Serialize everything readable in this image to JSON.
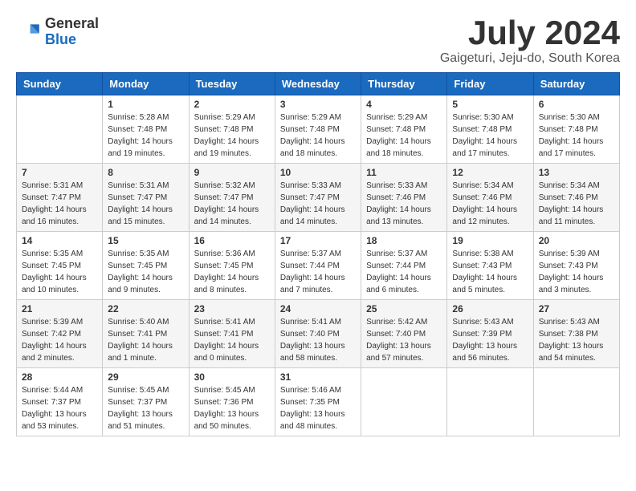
{
  "header": {
    "logo_general": "General",
    "logo_blue": "Blue",
    "month_title": "July 2024",
    "subtitle": "Gaigeturi, Jeju-do, South Korea"
  },
  "weekdays": [
    "Sunday",
    "Monday",
    "Tuesday",
    "Wednesday",
    "Thursday",
    "Friday",
    "Saturday"
  ],
  "weeks": [
    [
      {
        "day": "",
        "sunrise": "",
        "sunset": "",
        "daylight": ""
      },
      {
        "day": "1",
        "sunrise": "5:28 AM",
        "sunset": "7:48 PM",
        "daylight": "14 hours and 19 minutes."
      },
      {
        "day": "2",
        "sunrise": "5:29 AM",
        "sunset": "7:48 PM",
        "daylight": "14 hours and 19 minutes."
      },
      {
        "day": "3",
        "sunrise": "5:29 AM",
        "sunset": "7:48 PM",
        "daylight": "14 hours and 18 minutes."
      },
      {
        "day": "4",
        "sunrise": "5:29 AM",
        "sunset": "7:48 PM",
        "daylight": "14 hours and 18 minutes."
      },
      {
        "day": "5",
        "sunrise": "5:30 AM",
        "sunset": "7:48 PM",
        "daylight": "14 hours and 17 minutes."
      },
      {
        "day": "6",
        "sunrise": "5:30 AM",
        "sunset": "7:48 PM",
        "daylight": "14 hours and 17 minutes."
      }
    ],
    [
      {
        "day": "7",
        "sunrise": "5:31 AM",
        "sunset": "7:47 PM",
        "daylight": "14 hours and 16 minutes."
      },
      {
        "day": "8",
        "sunrise": "5:31 AM",
        "sunset": "7:47 PM",
        "daylight": "14 hours and 15 minutes."
      },
      {
        "day": "9",
        "sunrise": "5:32 AM",
        "sunset": "7:47 PM",
        "daylight": "14 hours and 14 minutes."
      },
      {
        "day": "10",
        "sunrise": "5:33 AM",
        "sunset": "7:47 PM",
        "daylight": "14 hours and 14 minutes."
      },
      {
        "day": "11",
        "sunrise": "5:33 AM",
        "sunset": "7:46 PM",
        "daylight": "14 hours and 13 minutes."
      },
      {
        "day": "12",
        "sunrise": "5:34 AM",
        "sunset": "7:46 PM",
        "daylight": "14 hours and 12 minutes."
      },
      {
        "day": "13",
        "sunrise": "5:34 AM",
        "sunset": "7:46 PM",
        "daylight": "14 hours and 11 minutes."
      }
    ],
    [
      {
        "day": "14",
        "sunrise": "5:35 AM",
        "sunset": "7:45 PM",
        "daylight": "14 hours and 10 minutes."
      },
      {
        "day": "15",
        "sunrise": "5:35 AM",
        "sunset": "7:45 PM",
        "daylight": "14 hours and 9 minutes."
      },
      {
        "day": "16",
        "sunrise": "5:36 AM",
        "sunset": "7:45 PM",
        "daylight": "14 hours and 8 minutes."
      },
      {
        "day": "17",
        "sunrise": "5:37 AM",
        "sunset": "7:44 PM",
        "daylight": "14 hours and 7 minutes."
      },
      {
        "day": "18",
        "sunrise": "5:37 AM",
        "sunset": "7:44 PM",
        "daylight": "14 hours and 6 minutes."
      },
      {
        "day": "19",
        "sunrise": "5:38 AM",
        "sunset": "7:43 PM",
        "daylight": "14 hours and 5 minutes."
      },
      {
        "day": "20",
        "sunrise": "5:39 AM",
        "sunset": "7:43 PM",
        "daylight": "14 hours and 3 minutes."
      }
    ],
    [
      {
        "day": "21",
        "sunrise": "5:39 AM",
        "sunset": "7:42 PM",
        "daylight": "14 hours and 2 minutes."
      },
      {
        "day": "22",
        "sunrise": "5:40 AM",
        "sunset": "7:41 PM",
        "daylight": "14 hours and 1 minute."
      },
      {
        "day": "23",
        "sunrise": "5:41 AM",
        "sunset": "7:41 PM",
        "daylight": "14 hours and 0 minutes."
      },
      {
        "day": "24",
        "sunrise": "5:41 AM",
        "sunset": "7:40 PM",
        "daylight": "13 hours and 58 minutes."
      },
      {
        "day": "25",
        "sunrise": "5:42 AM",
        "sunset": "7:40 PM",
        "daylight": "13 hours and 57 minutes."
      },
      {
        "day": "26",
        "sunrise": "5:43 AM",
        "sunset": "7:39 PM",
        "daylight": "13 hours and 56 minutes."
      },
      {
        "day": "27",
        "sunrise": "5:43 AM",
        "sunset": "7:38 PM",
        "daylight": "13 hours and 54 minutes."
      }
    ],
    [
      {
        "day": "28",
        "sunrise": "5:44 AM",
        "sunset": "7:37 PM",
        "daylight": "13 hours and 53 minutes."
      },
      {
        "day": "29",
        "sunrise": "5:45 AM",
        "sunset": "7:37 PM",
        "daylight": "13 hours and 51 minutes."
      },
      {
        "day": "30",
        "sunrise": "5:45 AM",
        "sunset": "7:36 PM",
        "daylight": "13 hours and 50 minutes."
      },
      {
        "day": "31",
        "sunrise": "5:46 AM",
        "sunset": "7:35 PM",
        "daylight": "13 hours and 48 minutes."
      },
      {
        "day": "",
        "sunrise": "",
        "sunset": "",
        "daylight": ""
      },
      {
        "day": "",
        "sunrise": "",
        "sunset": "",
        "daylight": ""
      },
      {
        "day": "",
        "sunrise": "",
        "sunset": "",
        "daylight": ""
      }
    ]
  ]
}
